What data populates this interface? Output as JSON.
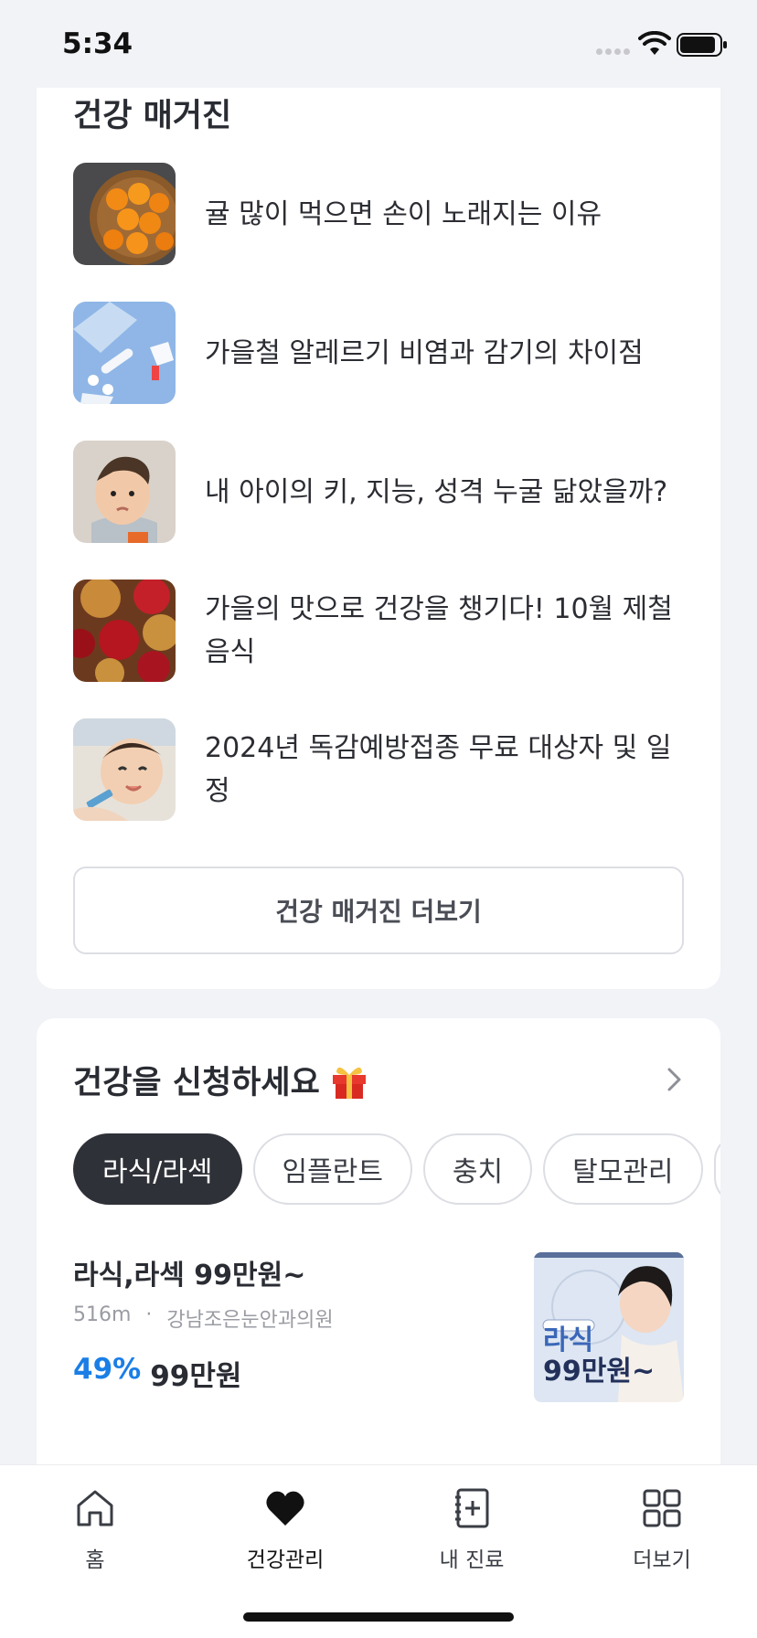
{
  "status_bar": {
    "time": "5:34"
  },
  "magazine": {
    "title": "건강 매거진",
    "items": [
      {
        "text": "귤 많이 먹으면 손이 노래지는 이유",
        "thumb": "tangerines-photo"
      },
      {
        "text": "가을철 알레르기 비염과 감기의 차이점",
        "thumb": "medicine-photo"
      },
      {
        "text": "내 아이의 키, 지능, 성격 누굴 닮았을까?",
        "thumb": "baby-photo"
      },
      {
        "text": "가을의 맛으로 건강을 챙기다! 10월 제철 음식",
        "thumb": "apples-pears-photo"
      },
      {
        "text": "2024년 독감예방접종 무료 대상자 및 일정",
        "thumb": "infant-vaccine-photo"
      }
    ],
    "more_label": "건강 매거진 더보기"
  },
  "apply": {
    "title": "건강을 신청하세요",
    "chips": [
      "라식/라섹",
      "임플란트",
      "충치",
      "탈모관리"
    ],
    "active_chip": "라식/라섹",
    "deal": {
      "title": "라식,라섹 99만원~",
      "distance": "516m",
      "separator": "·",
      "clinic": "강남조은눈안과의원",
      "discount": "49%",
      "price": "99만원",
      "image_line1": "라식",
      "image_line2": "99만원~"
    }
  },
  "tab_bar": {
    "items": [
      {
        "label": "홈",
        "icon": "home-icon"
      },
      {
        "label": "건강관리",
        "icon": "heart-icon"
      },
      {
        "label": "내 진료",
        "icon": "medical-record-icon"
      },
      {
        "label": "더보기",
        "icon": "grid-icon"
      }
    ],
    "active": "건강관리"
  },
  "colors": {
    "accent_blue": "#1a7ee6",
    "chip_active": "#2f3138",
    "background": "#f2f3f7"
  }
}
